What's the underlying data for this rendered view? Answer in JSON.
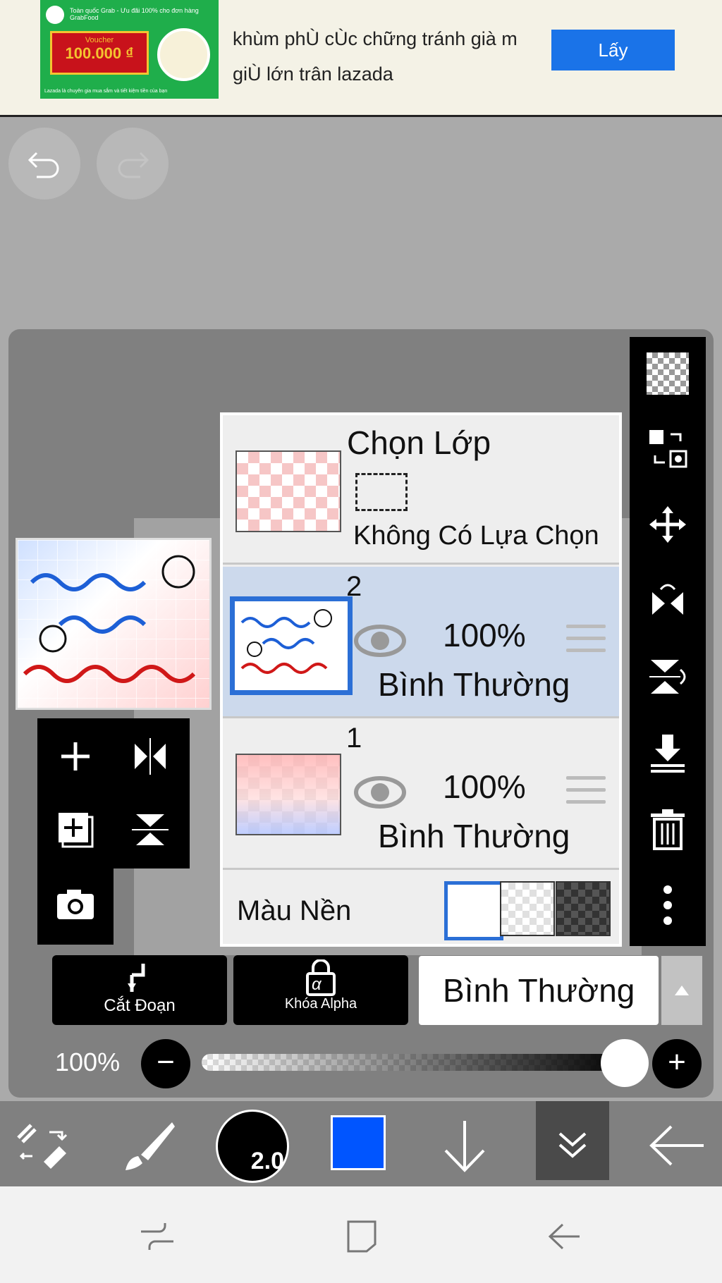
{
  "ad": {
    "image_small_text": "Toàn quốc Grab - Ưu đãi 100% cho đơn hàng GrabFood",
    "voucher_label": "Voucher",
    "voucher_amount": "100.000 ₫",
    "image_footer": "Lazada là chuyên gia mua sắm và tiết kiệm tiền của bạn",
    "text": "khùm phÙ cÙc chững tránh già m giÙ lớn trân lazada",
    "cta": "Lấy"
  },
  "layers_panel": {
    "select_title": "Chọn Lớp",
    "select_none": "Không Có Lựa Chọn",
    "layers": [
      {
        "number": "2",
        "opacity": "100%",
        "blend": "Bình Thường",
        "selected": true
      },
      {
        "number": "1",
        "opacity": "100%",
        "blend": "Bình Thường",
        "selected": false
      }
    ],
    "background_label": "Màu Nền"
  },
  "bottom_tools": {
    "cut_label": "Cắt Đoạn",
    "alpha_label": "Khóa Alpha",
    "alpha_symbol": "α",
    "blend_mode": "Bình Thường"
  },
  "opacity": {
    "label": "100%",
    "value": 1.0
  },
  "toolbar": {
    "brush_size": "2.0",
    "color": "#0055ff"
  },
  "colors": {
    "panel_bg": "#eeeeee",
    "selected_row": "#ccd9ec",
    "accent": "#1a73e8",
    "toolbar_bg": "#808080"
  },
  "icons": [
    "undo-icon",
    "redo-icon",
    "transparent-icon",
    "select-transform-icon",
    "move-icon",
    "flip-horizontal-icon",
    "flip-vertical-icon",
    "merge-down-icon",
    "trash-icon",
    "more-icon",
    "add-layer-icon",
    "add-layer-copy-icon",
    "camera-icon",
    "eye-icon",
    "lock-icon",
    "clip-arrow-icon",
    "tool-switch-icon",
    "brush-icon",
    "arrow-down-icon",
    "chevron-double-down-icon",
    "back-arrow-icon"
  ]
}
